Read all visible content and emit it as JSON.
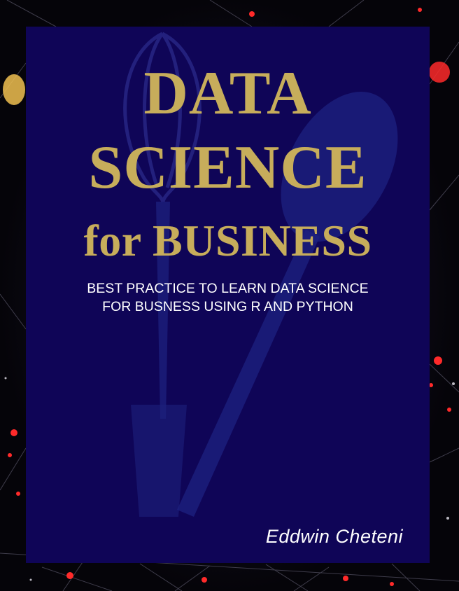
{
  "cover": {
    "title_line1": "DATA",
    "title_line2": "SCIENCE",
    "title_line3": "for BUSINESS",
    "subtitle_line1": "BEST PRACTICE TO LEARN DATA SCIENCE",
    "subtitle_line2": "FOR BUSNESS USING R AND PYTHON",
    "author": "Eddwin Cheteni",
    "background_color": "#0f0557",
    "title_color": "#c7ad5b",
    "text_color": "#ffffff"
  },
  "backdrop": {
    "icon": "network-bokeh-background",
    "accent_color": "#ff2a2a"
  },
  "watermark": {
    "icon": "whisk-and-spoon-silhouette"
  }
}
